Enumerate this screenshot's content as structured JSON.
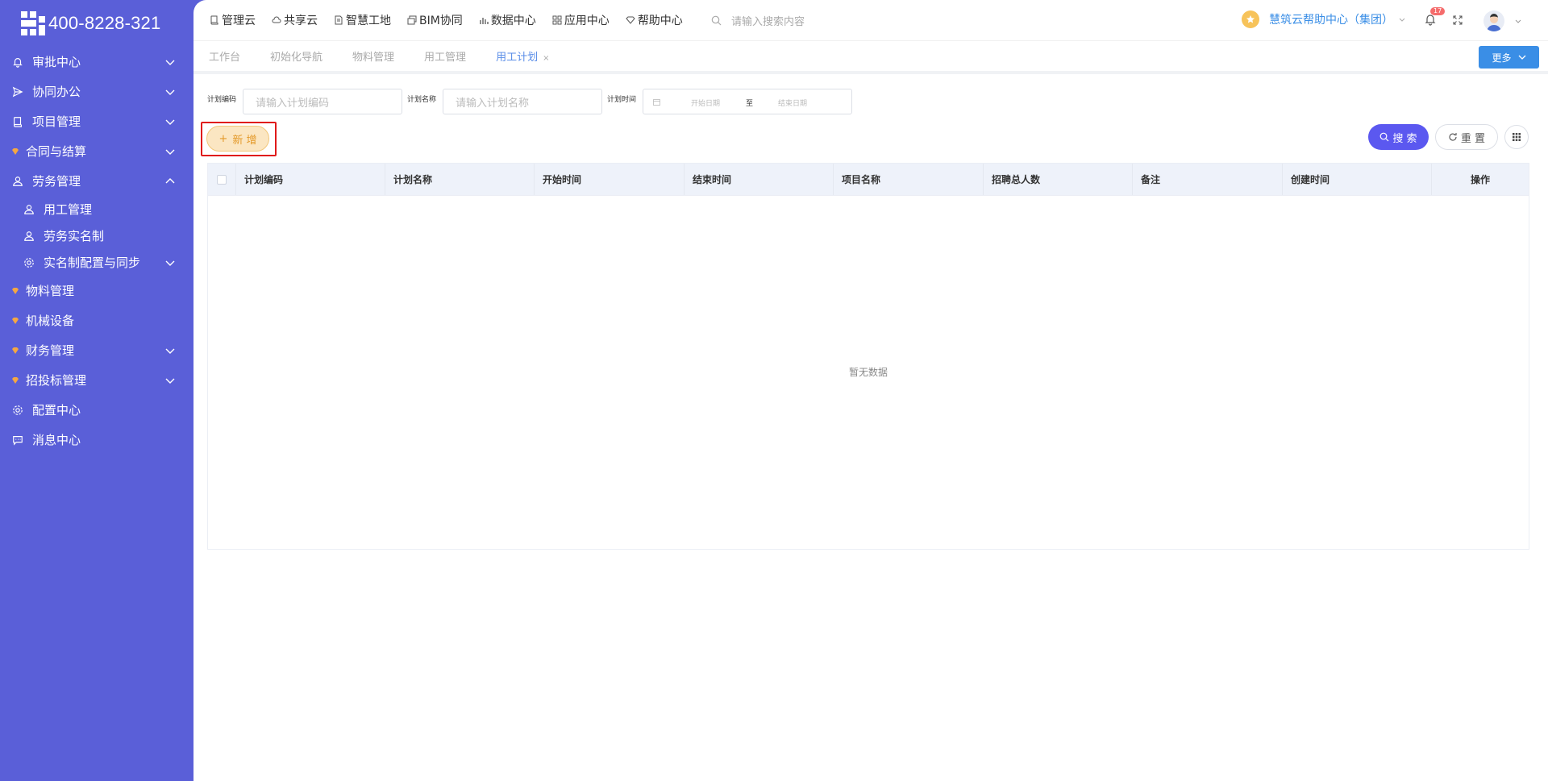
{
  "brand": {
    "phone": "400-8228-321"
  },
  "sidebar": {
    "items": [
      {
        "label": "审批中心",
        "icon": "bell-icon"
      },
      {
        "label": "协同办公",
        "icon": "send-icon"
      },
      {
        "label": "项目管理",
        "icon": "book-icon"
      },
      {
        "label": "合同与结算",
        "icon": "gem-icon"
      },
      {
        "label": "劳务管理",
        "icon": "user-icon"
      },
      {
        "label": "物料管理",
        "icon": "gem-icon"
      },
      {
        "label": "机械设备",
        "icon": "gem-icon"
      },
      {
        "label": "财务管理",
        "icon": "gem-icon"
      },
      {
        "label": "招投标管理",
        "icon": "gem-icon"
      },
      {
        "label": "配置中心",
        "icon": "gear-icon"
      },
      {
        "label": "消息中心",
        "icon": "chat-icon"
      }
    ],
    "sub": [
      {
        "label": "用工管理",
        "icon": "user-icon"
      },
      {
        "label": "劳务实名制",
        "icon": "user-icon"
      },
      {
        "label": "实名制配置与同步",
        "icon": "gear-icon"
      }
    ]
  },
  "topnav": [
    {
      "label": "管理云",
      "icon": "book-icon"
    },
    {
      "label": "共享云",
      "icon": "cloud-icon"
    },
    {
      "label": "智慧工地",
      "icon": "doc-icon"
    },
    {
      "label": "BIM协同",
      "icon": "cube-icon"
    },
    {
      "label": "数据中心",
      "icon": "bar-chart-icon"
    },
    {
      "label": "应用中心",
      "icon": "grid-icon"
    },
    {
      "label": "帮助中心",
      "icon": "diamond-icon"
    }
  ],
  "search": {
    "placeholder": "请输入搜索内容"
  },
  "user": {
    "org": "慧筑云帮助中心（集团）",
    "notifications": "17"
  },
  "tabs": [
    {
      "label": "工作台"
    },
    {
      "label": "初始化导航"
    },
    {
      "label": "物料管理"
    },
    {
      "label": "用工管理"
    },
    {
      "label": "用工计划",
      "active": true,
      "close": "×"
    }
  ],
  "more_label": "更多",
  "filters": {
    "code_label": "计划编码",
    "code_placeholder": "请输入计划编码",
    "name_label": "计划名称",
    "name_placeholder": "请输入计划名称",
    "time_label": "计划时间",
    "start_placeholder": "开始日期",
    "range_sep": "至",
    "end_placeholder": "结束日期"
  },
  "actions": {
    "add": "新 增",
    "search": "搜 索",
    "reset": "重 置"
  },
  "table": {
    "columns": [
      "计划编码",
      "计划名称",
      "开始时间",
      "结束时间",
      "项目名称",
      "招聘总人数",
      "备注",
      "创建时间",
      "操作"
    ],
    "empty_text": "暂无数据"
  }
}
